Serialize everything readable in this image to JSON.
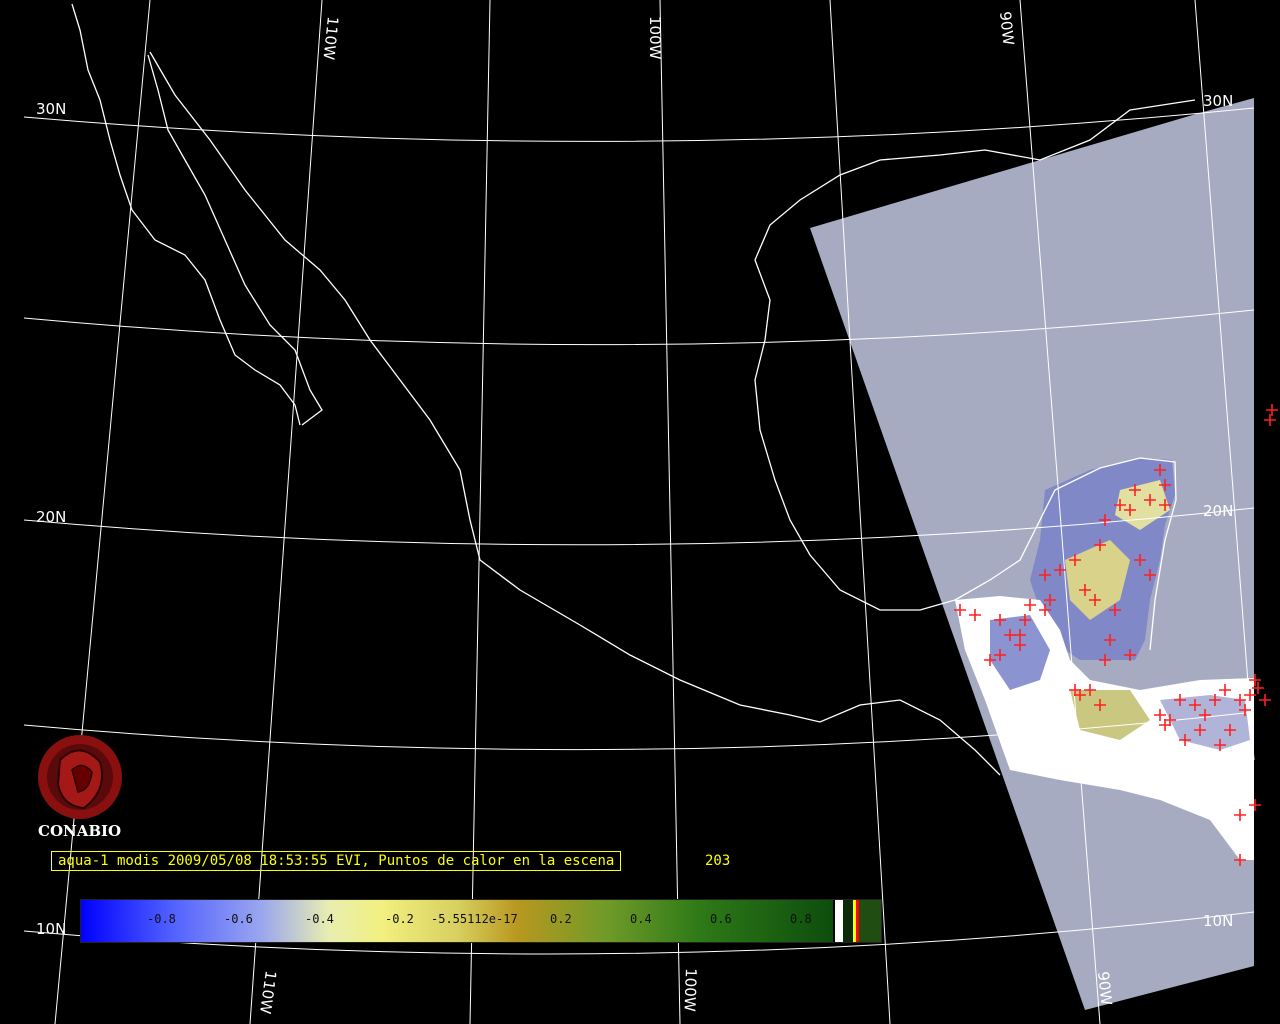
{
  "map": {
    "grid_labels": {
      "lat_30_left": "30N",
      "lat_20_left": "20N",
      "lat_10_left": "10N",
      "lat_30_right": "30N",
      "lat_20_right": "20N",
      "lat_10_right": "10N",
      "lon_110_top": "110W",
      "lon_100_top": "100W",
      "lon_90_top": "90W",
      "lon_110_bottom": "110W",
      "lon_100_bottom": "100W",
      "lon_90_bottom": "90W"
    },
    "swath_color": "#a6abc2",
    "coast_color": "#ffffff",
    "hotspot_color": "#ff2020"
  },
  "logo": {
    "name": "CONABIO",
    "color": "#8a1010"
  },
  "caption": {
    "text": "aqua-1 modis 2009/05/08 18:53:55 EVI, Puntos de calor en la escena",
    "count": "203"
  },
  "colorbar": {
    "labels": [
      "-0.8",
      "-0.6",
      "-0.4",
      "-0.2",
      "-5.55112e-17",
      "0.2",
      "0.4",
      "0.6",
      "0.8"
    ]
  }
}
